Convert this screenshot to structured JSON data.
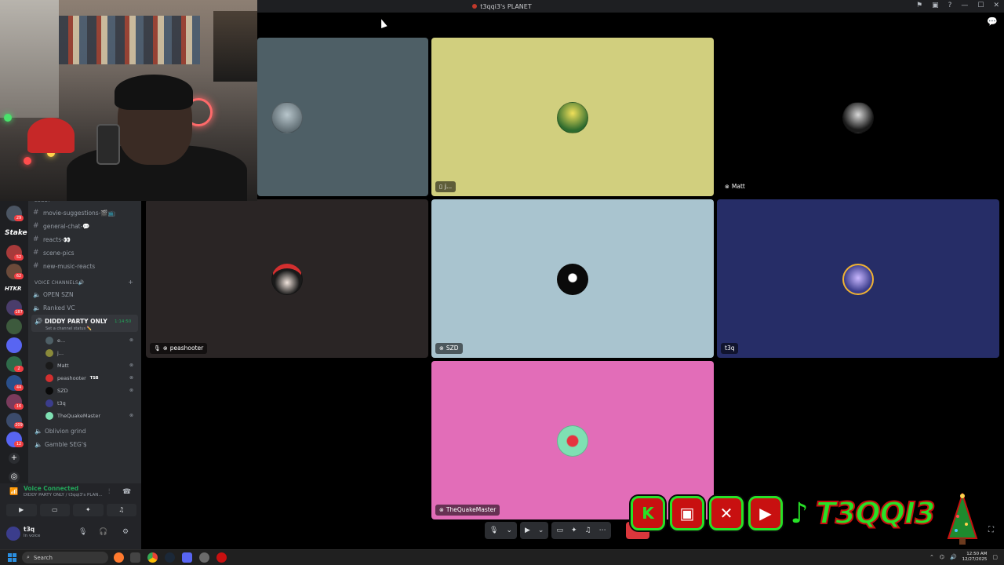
{
  "window": {
    "title": "t3qqi3's PLANET"
  },
  "sidebar": {
    "category_lobby": "LOBBY",
    "text_channels": [
      {
        "name": "movie-suggestions-🎬📺"
      },
      {
        "name": "general-chat-💬"
      },
      {
        "name": "reacts-👀"
      },
      {
        "name": "scene-pics"
      },
      {
        "name": "new-music-reacts"
      }
    ],
    "voice_category": "VOICE CHANNELS🔊",
    "voice_channels": [
      {
        "name": "OPEN SZN"
      },
      {
        "name": "Ranked VC"
      }
    ],
    "active_voice": {
      "name": "DIDDY PARTY ONLY",
      "timer": "1:14:50",
      "status": "Set a channel status ✏️"
    },
    "members": [
      {
        "name": "e..."
      },
      {
        "name": "j..."
      },
      {
        "name": "Matt"
      },
      {
        "name": "peashooter",
        "tag": "TSB"
      },
      {
        "name": "SZD"
      },
      {
        "name": "t3q"
      },
      {
        "name": "TheQuakeMaster"
      }
    ],
    "more_voice": [
      {
        "name": "Oblivion grind"
      },
      {
        "name": "Gamble SEG'$"
      }
    ]
  },
  "rail": {
    "badges": [
      "29",
      "52",
      "62",
      "187",
      "2",
      "44",
      "16",
      "209",
      "12"
    ],
    "stake": "Stake",
    "htkr": "HTKR"
  },
  "voice_panel": {
    "status": "Voice Connected",
    "location": "DIDDY PARTY ONLY / t3qqi3's PLAN..."
  },
  "user": {
    "name": "t3q",
    "status": "In voice"
  },
  "tiles": [
    {
      "name": "",
      "bg": "#4e5f66"
    },
    {
      "name": "j...",
      "bg": "#d1cf7e"
    },
    {
      "name": "Matt",
      "bg": "#000000"
    },
    {
      "name": "peashooter",
      "bg": "#2a2525"
    },
    {
      "name": "SZD",
      "bg": "#a9c4cf"
    },
    {
      "name": "t3q",
      "bg": "#262d67"
    },
    {
      "name": "TheQuakeMaster",
      "bg": "#e26db8"
    }
  ],
  "overlay": {
    "brand": "T3QQI3",
    "kick": "K"
  },
  "taskbar": {
    "search": "Search",
    "time": "12:50 AM",
    "date": "12/27/2025"
  },
  "colors": {
    "accent_green": "#23a55a",
    "danger": "#da373c",
    "overlay_green": "#27e227",
    "overlay_red": "#c81010"
  }
}
